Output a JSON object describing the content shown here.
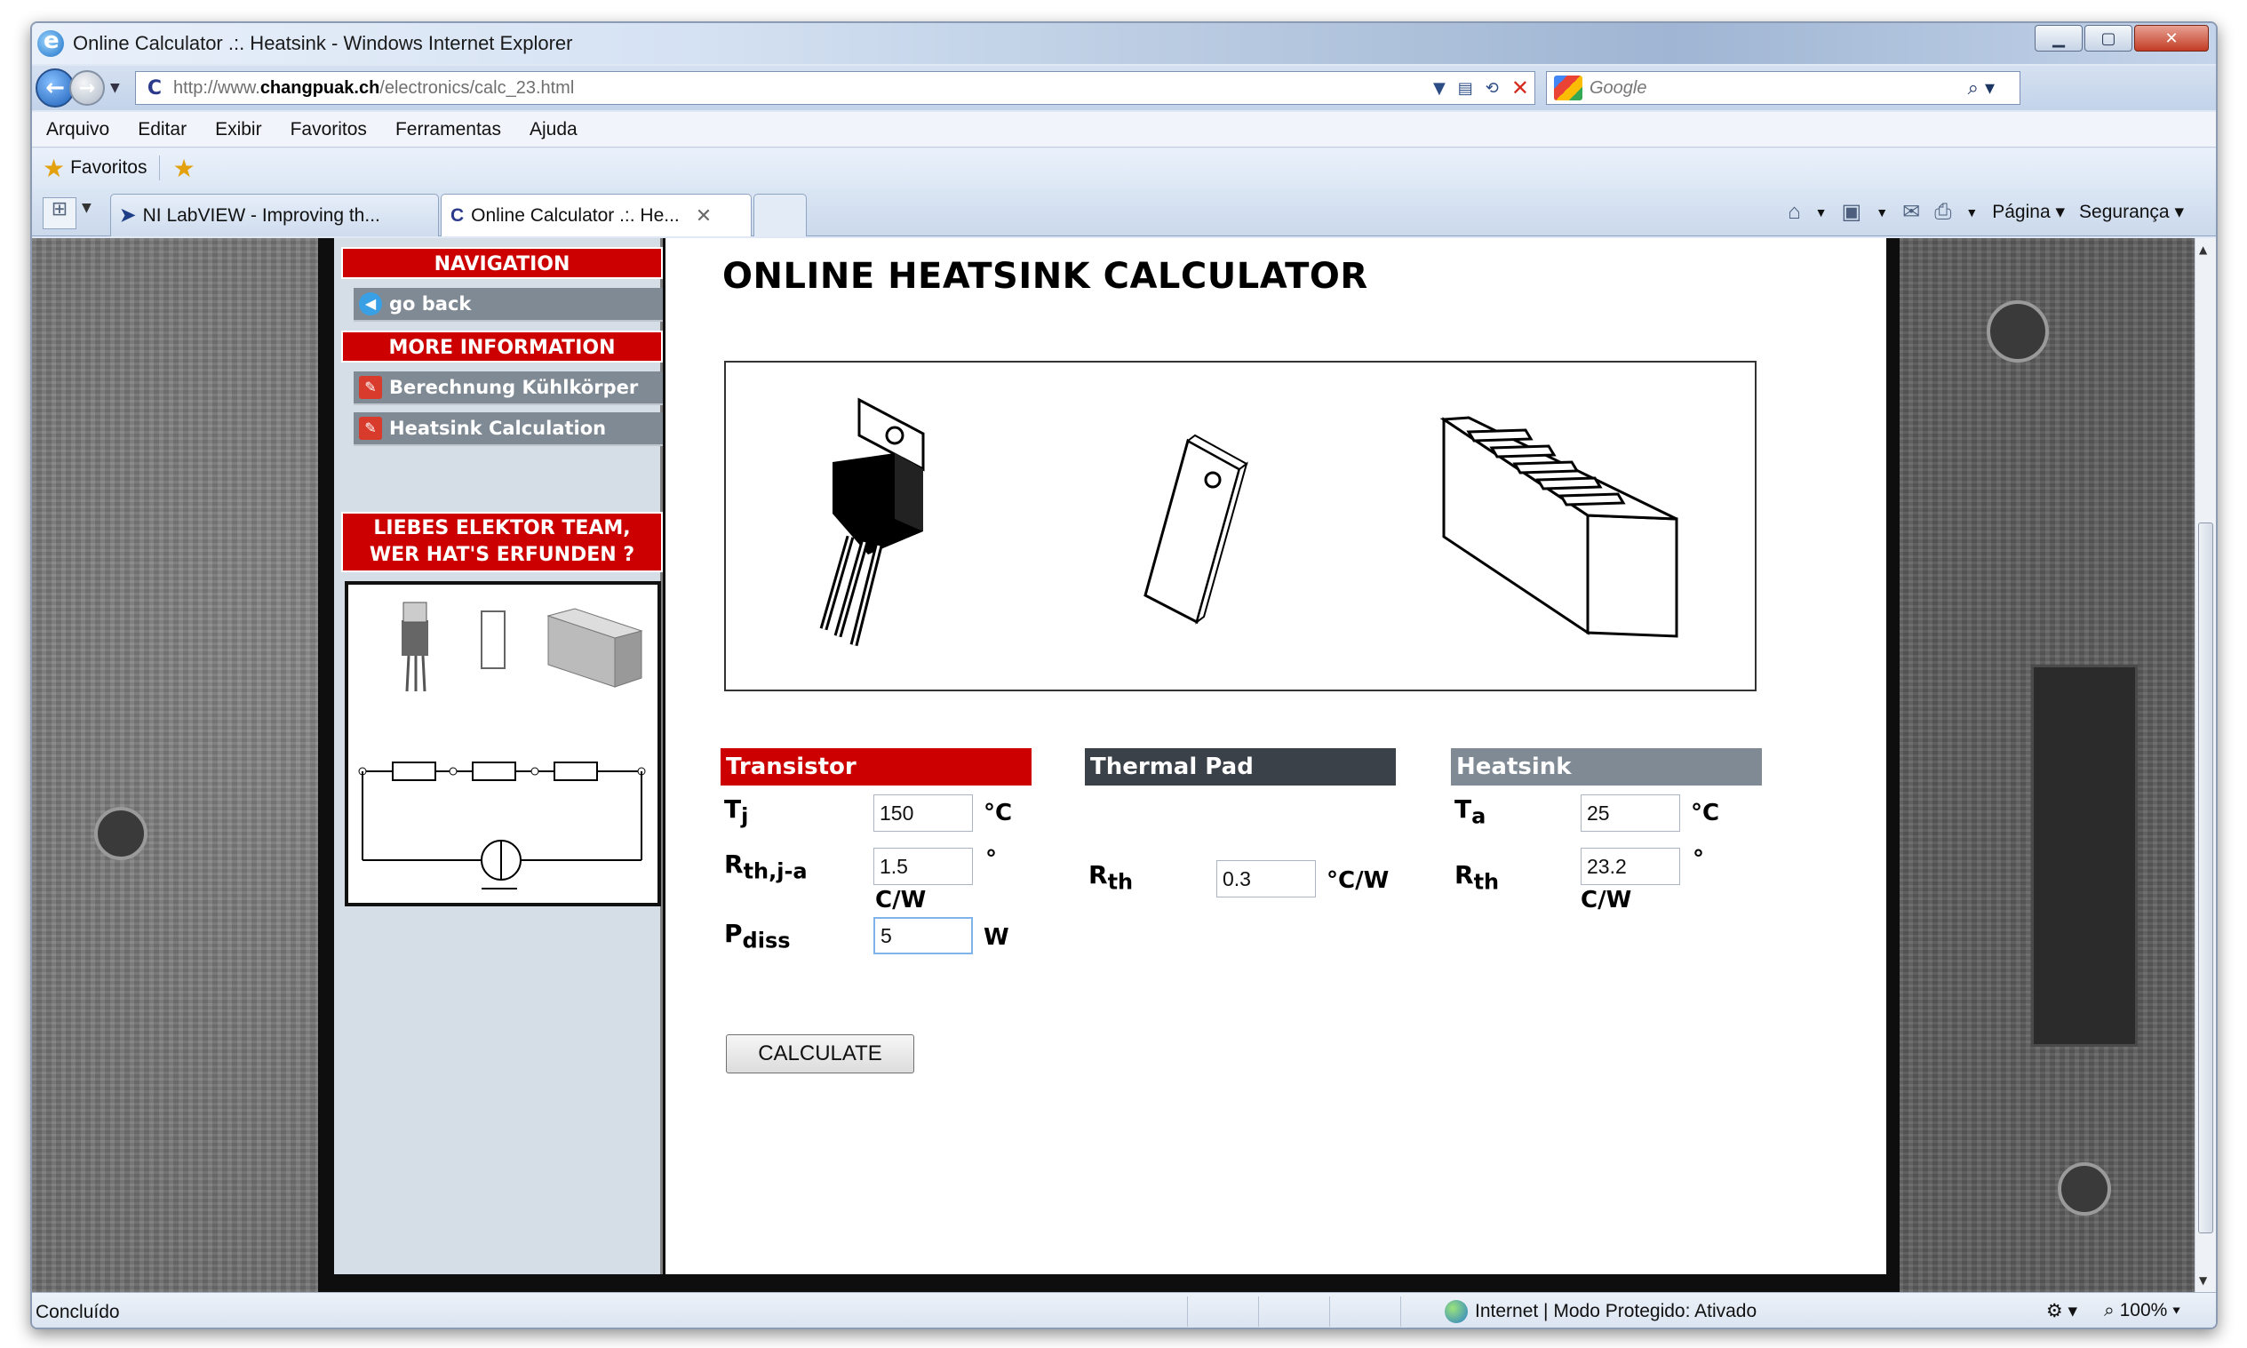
{
  "window": {
    "title": "Online Calculator .:. Heatsink - Windows Internet Explorer",
    "minimize": "▁",
    "maximize": "▢",
    "close": "✕"
  },
  "address": {
    "url_prefix": "http://www.",
    "url_domain": "changpuak.ch",
    "url_path": "/electronics/calc_23.html",
    "search_placeholder": "Google"
  },
  "menu": [
    "Arquivo",
    "Editar",
    "Exibir",
    "Favoritos",
    "Ferramentas",
    "Ajuda"
  ],
  "favorites": {
    "label": "Favoritos"
  },
  "tabs": [
    {
      "label": "NI LabVIEW - Improving th...",
      "icon": "labview-icon"
    },
    {
      "label": "Online Calculator .:. He...",
      "icon": "changpuak-icon",
      "active": true
    }
  ],
  "command_bar": {
    "page": "Página",
    "security": "Segurança"
  },
  "sidebar": {
    "navigation_header": "NAVIGATION",
    "go_back": "go back",
    "more_info_header": "MORE INFORMATION",
    "links": [
      "Berechnung Kühlkörper",
      "Heatsink Calculation"
    ],
    "promo_line1": "LIEBES ELEKTOR TEAM,",
    "promo_line2": "WER HAT'S ERFUNDEN ?"
  },
  "main": {
    "title": "ONLINE HEATSINK CALCULATOR",
    "transistor": {
      "header": "Transistor",
      "tj_label": "T",
      "tj_sub": "j",
      "tj_value": "150",
      "tj_unit": "°C",
      "rth_label": "R",
      "rth_sub": "th,j-a",
      "rth_value": "1.5",
      "rth_unit_top": "°",
      "rth_unit_bottom": "C/W",
      "pdiss_label": "P",
      "pdiss_sub": "diss",
      "pdiss_value": "5",
      "pdiss_unit": "W"
    },
    "thermal_pad": {
      "header": "Thermal Pad",
      "rth_label": "R",
      "rth_sub": "th",
      "rth_value": "0.3",
      "rth_unit": "°C/W"
    },
    "heatsink": {
      "header": "Heatsink",
      "ta_label": "T",
      "ta_sub": "a",
      "ta_value": "25",
      "ta_unit": "°C",
      "rth_label": "R",
      "rth_sub": "th",
      "rth_value": "23.2",
      "rth_unit_top": "°",
      "rth_unit_bottom": "C/W"
    },
    "calculate_button": "CALCULATE"
  },
  "status": {
    "left": "Concluído",
    "zone": "Internet | Modo Protegido: Ativado",
    "zoom": "100%"
  }
}
